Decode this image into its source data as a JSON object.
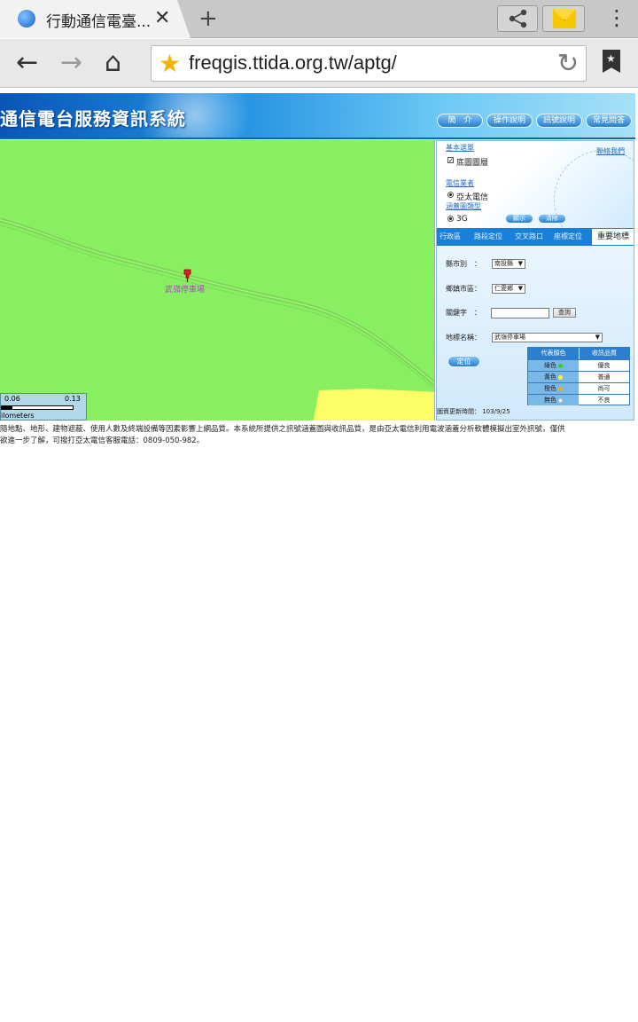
{
  "browser": {
    "tab": {
      "title": "行動通信電臺...",
      "close": "✕"
    },
    "new_tab": "+",
    "menu": "⋮",
    "nav": {
      "back": "←",
      "forward": "→",
      "home": "⌂"
    },
    "url": "freqgis.ttida.org.tw/aptg/",
    "reload": "↻"
  },
  "site": {
    "title": "通信電台服務資訊系統",
    "nav": [
      "簡　介",
      "操作說明",
      "訊號說明",
      "常見問答"
    ]
  },
  "map": {
    "pin_label": "武嶺停車場",
    "scale": {
      "val1": "0.06",
      "val2": "0.13",
      "unit": "ilometers"
    }
  },
  "panel": {
    "basic_layers": "基本選單",
    "base_layer": "底圖圖層",
    "contact": "聯絡我們",
    "operator_heading": "電信業者",
    "operator": "亞太電信",
    "coverage_type": "涵蓋圖類型",
    "network": "3G",
    "show_btn": "顯示",
    "clear_btn": "清除",
    "tabs": [
      "行政區",
      "路段定位",
      "交叉路口",
      "座標定位"
    ],
    "active_tab": "重要地標",
    "form": {
      "county_label": "縣市別　：",
      "county_value": "南投縣",
      "town_label": "鄉鎮市區：",
      "town_value": "仁愛鄉",
      "keyword_label": "關鍵字　：",
      "query_btn": "查詢",
      "landmark_label": "地標名稱：",
      "landmark_value": "武嶺停車場",
      "locate_btn": "定位"
    },
    "legend": {
      "col1": "代表顏色",
      "col2": "收訊品質",
      "rows": [
        {
          "color_name": "綠色",
          "dot": "#33cc33",
          "quality": "優良"
        },
        {
          "color_name": "黃色",
          "dot": "#f5f53a",
          "quality": "普通"
        },
        {
          "color_name": "橙色",
          "dot": "#f5a623",
          "quality": "尚可"
        },
        {
          "color_name": "無色",
          "dot": "#ffffff",
          "quality": "不良"
        }
      ]
    },
    "update_time": "圖資更新時間： 103/9/25"
  },
  "disclaimer": {
    "line1": "隨地點、地形、建物遮蔽、使用人數及終端設備等因素影響上網品質。本系統所提供之訊號涵蓋圖與收訊品質，是由亞太電信利用電波涵蓋分析軟體模擬出室外訊號，僅供",
    "line2": "欲進一步了解，可撥打亞太電信客服電話：0809-050-982。"
  },
  "colors": {
    "map_green": "#88f060",
    "map_yellow": "#fdfd68",
    "header_blue": "#1e8fe0",
    "star": "#f3b300"
  }
}
